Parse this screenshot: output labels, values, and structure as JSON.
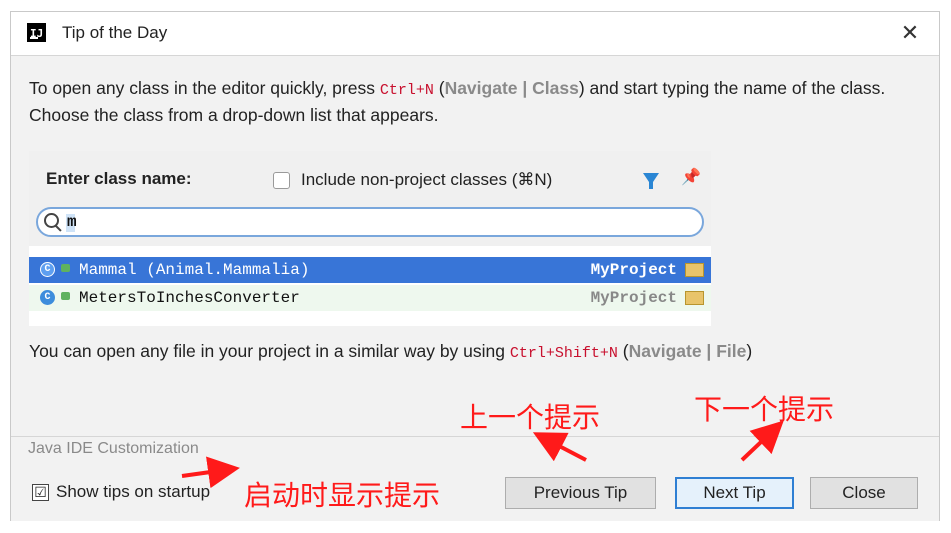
{
  "window": {
    "title": "Tip of the Day",
    "close_glyph": "✕"
  },
  "tip": {
    "line1_prefix": "To open any class in the editor quickly, press ",
    "line1_shortcut": "Ctrl+N",
    "line1_paren_open": " (",
    "line1_nav1": "Navigate",
    "line1_sep": " | ",
    "line1_nav2": "Class",
    "line1_suffix": ") and start typing the name of the class. Choose the class from a drop-down list that appears.",
    "line2_prefix": "You can open any file in your project in a similar way by using ",
    "line2_shortcut": "Ctrl+Shift+N",
    "line2_paren_open": " (",
    "line2_nav1": "Navigate",
    "line2_sep": " | ",
    "line2_nav2": "File",
    "line2_suffix": ")"
  },
  "example": {
    "label": "Enter class name:",
    "checkbox_label": "Include non-project classes (⌘N)",
    "search_value": "m",
    "rows": [
      {
        "icon": "C",
        "name": "Mammal (Animal.Mammalia)",
        "project": "MyProject"
      },
      {
        "icon": "C",
        "name": "MetersToInchesConverter",
        "project": "MyProject"
      }
    ]
  },
  "footer": {
    "source": "Java IDE Customization",
    "show_tips_label": "Show tips on startup",
    "show_tips_checked": "☑",
    "prev_button": "Previous Tip",
    "next_button": "Next Tip",
    "close_button": "Close"
  },
  "annotations": {
    "prev": "上一个提示",
    "next": "下一个提示",
    "startup": "启动时显示提示"
  },
  "colors": {
    "shortcut": "#c8102e",
    "selection": "#3875d7",
    "annotation": "#ff1a1a"
  }
}
